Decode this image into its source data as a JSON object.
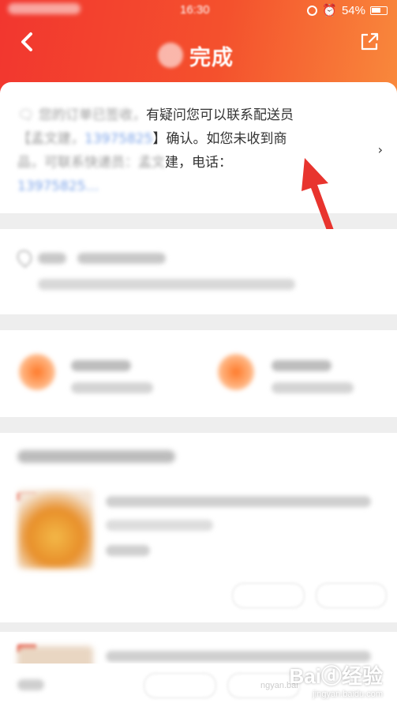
{
  "status_bar": {
    "time": "16:30",
    "battery": "54%"
  },
  "header": {
    "title": "完成"
  },
  "notice": {
    "line1_visible": "有疑问您可以联系配送员",
    "line2_visible": "】确认。如您未收到商",
    "line3_visible": "建，电话："
  },
  "watermark": {
    "brand": "Baiⓓ经验",
    "url": "jingyan.baidu.com",
    "url_left": "ngyan.bai"
  },
  "colors": {
    "header_start": "#f2362f",
    "header_end": "#f98a3c",
    "arrow": "#e8342e",
    "link": "#7aa2e8"
  }
}
